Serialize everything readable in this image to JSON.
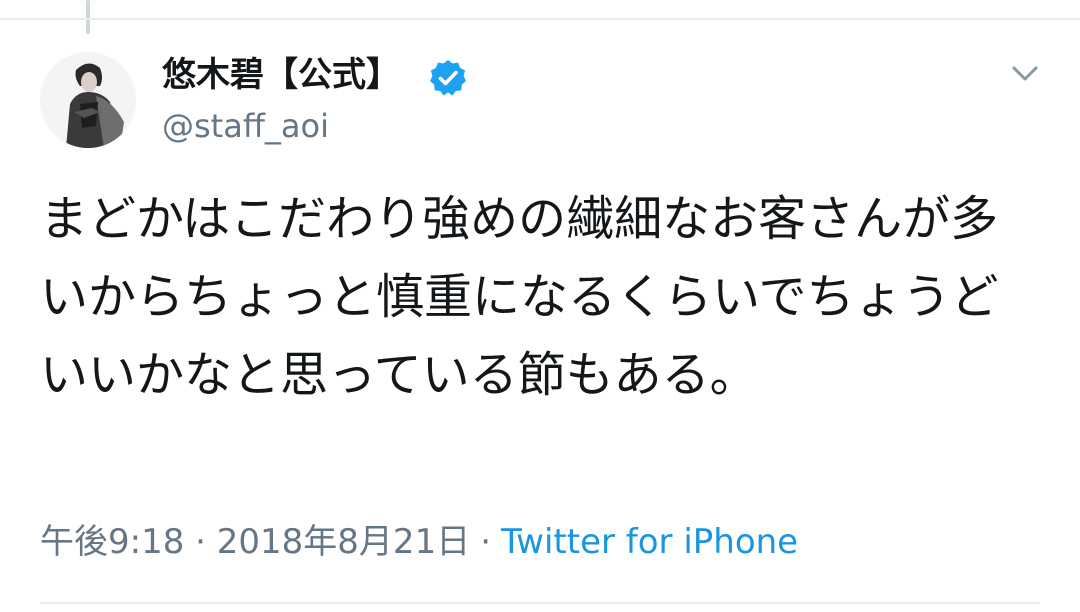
{
  "tweet": {
    "author": {
      "display_name": "悠木碧【公式】",
      "handle": "@staff_aoi",
      "verified": true,
      "avatar_icon": "profile-photo"
    },
    "text": "まどかはこだわり強めの繊細なお客さんが多いからちょっと慎重になるくらいでちょうどいいかなと思っている節もある。",
    "timestamp": "午後9:18 · 2018年8月21日",
    "separator": "·",
    "source": "Twitter for iPhone",
    "menu_icon": "chevron-down-icon"
  },
  "colors": {
    "text_primary": "#14171a",
    "text_secondary": "#657786",
    "link": "#1b95e0",
    "verified": "#1da1f2",
    "divider": "#e6ecf0"
  }
}
